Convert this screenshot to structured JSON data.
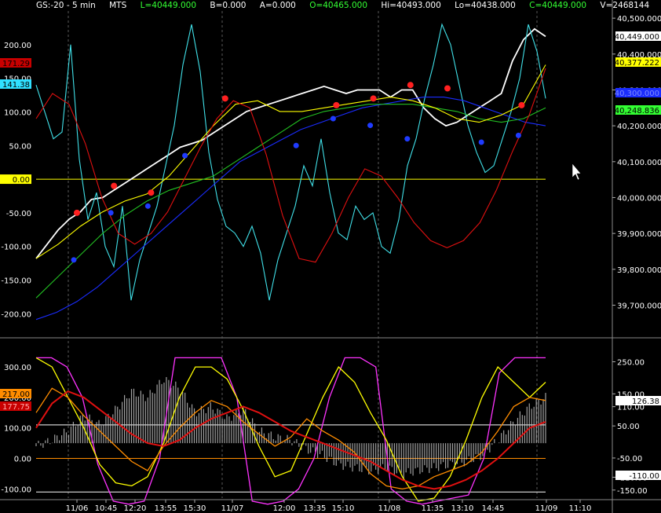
{
  "colors": {
    "background": "#000000",
    "grid": "#5a5a5a",
    "price": "#ffffff",
    "cyan": "#40e0e8",
    "blue": "#1a2cff",
    "green": "#22c022",
    "yellow": "#ffff00",
    "red": "#e01010",
    "orange": "#ff8c00",
    "magenta": "#ff33ff",
    "gray": "#c8c8c8",
    "dot_red": "#ff2020",
    "dot_blue": "#1f3bff"
  },
  "header": {
    "symbol": "GS:-20 - 5 min",
    "exchange": "MTS",
    "last": "L=40449.000",
    "bid": "B=0.000",
    "ask": "A=0.000",
    "open": "O=40465.000",
    "high": "Hi=40493.000",
    "low": "Lo=40438.000",
    "close": "C=40449.000",
    "volume": "V=2468144"
  },
  "chart_data": [
    {
      "type": "line",
      "panel": "price",
      "right_axis": {
        "ticks": [
          "40,500.000",
          "40,400.000",
          "40,300.000",
          "40,200.000",
          "40,100.000",
          "40,000.000",
          "39,900.000",
          "39,800.000",
          "39,700.000"
        ],
        "ylim": [
          39620,
          40520
        ]
      },
      "left_axis": {
        "ticks": [
          "200.00",
          "150.00",
          "100.00",
          "50.00",
          "0.00",
          "-50.00",
          "-100.00",
          "-150.00",
          "-200.00"
        ],
        "ylim": [
          -230,
          250
        ]
      },
      "left_badges": [
        "171.29",
        "141.38",
        "0.00"
      ],
      "right_badges": [
        "40,449.000",
        "40,377.222",
        "40,300.000",
        "40,248.836"
      ],
      "x_labels": [
        "11/06",
        "10:45",
        "12:20",
        "13:55",
        "15:30",
        "11/07",
        "12:00",
        "13:35",
        "15:10",
        "11/08",
        "11:35",
        "13:10",
        "14:45",
        "11/09",
        "11:10"
      ],
      "series": [
        {
          "color_key": "price",
          "axis": "right",
          "values": [
            39830,
            39870,
            39910,
            39940,
            39960,
            39995,
            40000,
            40020,
            40040,
            40060,
            40080,
            40100,
            40120,
            40140,
            40150,
            40160,
            40180,
            40200,
            40220,
            40240,
            40250,
            40260,
            40270,
            40280,
            40290,
            40300,
            40310,
            40300,
            40290,
            40300,
            40300,
            40300,
            40280,
            40300,
            40300,
            40250,
            40220,
            40200,
            40210,
            40230,
            40250,
            40270,
            40290,
            40380,
            40440,
            40470,
            40449
          ]
        },
        {
          "color_key": "cyan",
          "axis": "left",
          "values": [
            140,
            100,
            60,
            70,
            200,
            30,
            -60,
            -20,
            -100,
            -130,
            -40,
            -180,
            -120,
            -80,
            -40,
            20,
            80,
            170,
            230,
            160,
            40,
            -30,
            -70,
            -80,
            -100,
            -70,
            -110,
            -180,
            -120,
            -80,
            -40,
            20,
            -10,
            60,
            -20,
            -80,
            -90,
            -40,
            -60,
            -50,
            -100,
            -110,
            -60,
            20,
            60,
            120,
            170,
            230,
            200,
            140,
            80,
            40,
            10,
            20,
            60,
            100,
            150,
            230,
            190,
            120
          ]
        },
        {
          "color_key": "blue",
          "axis": "right",
          "values": [
            39660,
            39680,
            39710,
            39750,
            39800,
            39850,
            39900,
            39950,
            40000,
            40050,
            40100,
            40130,
            40160,
            40190,
            40210,
            40230,
            40250,
            40260,
            40270,
            40280,
            40280,
            40270,
            40250,
            40230,
            40210,
            40200
          ]
        },
        {
          "color_key": "green",
          "axis": "right",
          "values": [
            39720,
            39780,
            39840,
            39900,
            39950,
            39990,
            40020,
            40040,
            40060,
            40100,
            40140,
            40180,
            40220,
            40240,
            40250,
            40260,
            40260,
            40260,
            40250,
            40240,
            40220,
            40210,
            40220,
            40250
          ]
        },
        {
          "color_key": "yellow",
          "axis": "right",
          "values": [
            39830,
            39870,
            39920,
            39960,
            39990,
            40010,
            40060,
            40130,
            40200,
            40260,
            40270,
            40240,
            40240,
            40250,
            40260,
            40270,
            40280,
            40270,
            40250,
            40220,
            40210,
            40230,
            40260,
            40370
          ]
        },
        {
          "color_key": "red",
          "axis": "right",
          "values": [
            40220,
            40290,
            40260,
            40150,
            40000,
            39900,
            39870,
            39900,
            39960,
            40050,
            40140,
            40220,
            40270,
            40250,
            40120,
            39950,
            39830,
            39820,
            39900,
            40000,
            40080,
            40060,
            40000,
            39930,
            39880,
            39860,
            39880,
            39930,
            40020,
            40130,
            40230,
            40360
          ]
        }
      ],
      "markers_red": [
        [
          "11/06",
          -50
        ],
        [
          "10:45",
          -10
        ],
        [
          "12:20",
          -20
        ],
        [
          "15:30",
          120
        ],
        [
          "13:35",
          110
        ],
        [
          "15:10",
          120
        ],
        [
          "11/08",
          140
        ],
        [
          "11:35",
          135
        ],
        [
          "14:45",
          110
        ]
      ],
      "markers_blue": [
        [
          "11/06",
          -120
        ],
        [
          "10:45",
          -50
        ],
        [
          "12:20",
          -40
        ],
        [
          "13:55",
          35
        ],
        [
          "12:00",
          50
        ],
        [
          "13:35",
          90
        ],
        [
          "15:10",
          80
        ],
        [
          "11/08",
          60
        ],
        [
          "13:10",
          55
        ],
        [
          "14:45",
          65
        ]
      ]
    },
    {
      "type": "line",
      "panel": "oscillator",
      "left_axis": {
        "ticks": [
          "300.00",
          "200.00",
          "100.00",
          "0.00",
          "-100.00"
        ],
        "ylim": [
          -130,
          380
        ]
      },
      "right_axis": {
        "ticks": [
          "250.00",
          "150.00",
          "110.00",
          "50.00",
          "-50.00",
          "-110.00",
          "-150.00"
        ],
        "ylim": [
          -175,
          310
        ]
      },
      "left_badges": [
        "217.00",
        "177.75"
      ],
      "right_badges": [
        "126.38",
        "-110.00"
      ],
      "levels": [
        110,
        -110,
        0
      ],
      "series": [
        {
          "color_key": "gray",
          "style": "histogram",
          "values": [
            40,
            60,
            90,
            140,
            110,
            160,
            220,
            200,
            260,
            230,
            150,
            170,
            130,
            160,
            90,
            70,
            60,
            30,
            10,
            -20,
            -30,
            -40,
            -30,
            -50,
            -40,
            -30,
            -20,
            -10,
            10,
            60,
            120,
            170,
            200
          ]
        },
        {
          "color_key": "magenta",
          "values": [
            330,
            330,
            300,
            200,
            -20,
            -140,
            -150,
            -140,
            0,
            330,
            330,
            330,
            330,
            200,
            -140,
            -150,
            -140,
            -100,
            0,
            200,
            330,
            330,
            300,
            -100,
            -140,
            -150,
            -140,
            -130,
            -120,
            0,
            280,
            330,
            330,
            330
          ]
        },
        {
          "color_key": "yellow",
          "values": [
            330,
            300,
            200,
            100,
            -20,
            -80,
            -90,
            -60,
            50,
            200,
            300,
            300,
            260,
            160,
            40,
            -60,
            -40,
            80,
            200,
            300,
            250,
            150,
            60,
            -60,
            -140,
            -130,
            -60,
            60,
            200,
            300,
            250,
            200,
            250
          ]
        },
        {
          "color_key": "orange",
          "values": [
            150,
            230,
            200,
            140,
            90,
            40,
            -10,
            -40,
            40,
            100,
            150,
            190,
            170,
            120,
            80,
            40,
            70,
            130,
            90,
            60,
            20,
            -50,
            -90,
            -100,
            -90,
            -60,
            -40,
            -20,
            20,
            90,
            170,
            200,
            190
          ]
        },
        {
          "color_key": "red",
          "values": [
            100,
            180,
            220,
            200,
            160,
            120,
            80,
            50,
            40,
            60,
            100,
            130,
            150,
            170,
            150,
            120,
            90,
            70,
            50,
            30,
            10,
            -10,
            -40,
            -70,
            -90,
            -100,
            -90,
            -70,
            -40,
            0,
            50,
            100,
            120
          ]
        }
      ]
    }
  ]
}
